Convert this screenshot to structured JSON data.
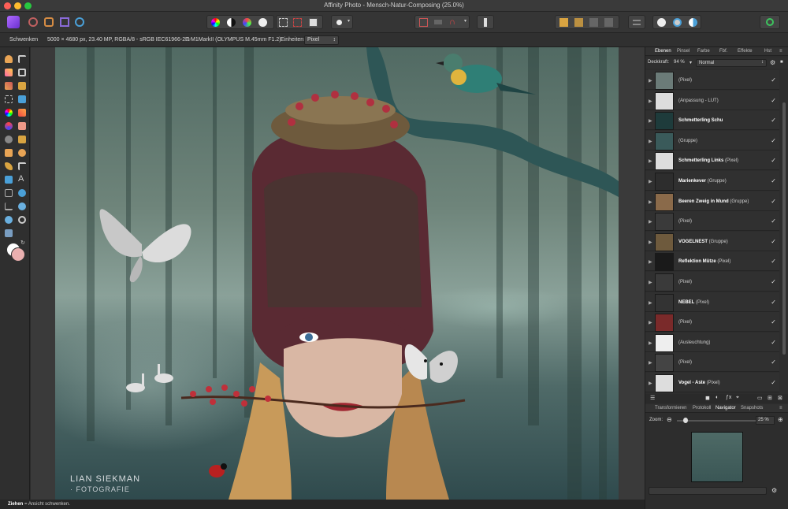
{
  "window": {
    "title": "Affinity Photo - Mensch-Natur-Composing (25.0%)"
  },
  "context": {
    "tool": "Schwenken",
    "docinfo": "5000 × 4680 px, 23.40 MP, RGBA/8 - sRGB IEC61966-2.1",
    "camera": "E-M1MarkII (OLYMPUS M.45mm F1.2)",
    "units_label": "Einheiten:",
    "units_value": "Pixel"
  },
  "canvas": {
    "watermark1": "LIAN SIEKMAN",
    "watermark2": "· FOTOGRAFIE"
  },
  "status": {
    "bold": "Ziehen",
    "rest": " = Ansicht schwenken."
  },
  "layers_panel": {
    "tabs": [
      "Ebenen",
      "Pinsel",
      "Farbe",
      "Fbf.",
      "Effekte",
      "Hst"
    ],
    "opacity_label": "Deckkraft:",
    "opacity_value": "94 %",
    "blend_mode": "Normal",
    "layers": [
      {
        "bold": "",
        "rest": "(Pixel)"
      },
      {
        "bold": "",
        "rest": "(Anpassung - LUT)"
      },
      {
        "bold": "Schmetterling Schu",
        "rest": ""
      },
      {
        "bold": "",
        "rest": "(Gruppe)"
      },
      {
        "bold": "Schmetterling Links",
        "rest": " (Pixel)"
      },
      {
        "bold": "Marienkever",
        "rest": " (Gruppe)"
      },
      {
        "bold": "Beeren Zweig in Mund",
        "rest": " (Gruppe)"
      },
      {
        "bold": "",
        "rest": "(Pixel)"
      },
      {
        "bold": "VOGELNEST",
        "rest": " (Gruppe)"
      },
      {
        "bold": "Reflektion Mütze",
        "rest": " (Pixel)"
      },
      {
        "bold": "",
        "rest": "(Pixel)"
      },
      {
        "bold": "NEBEL",
        "rest": " (Pixel)"
      },
      {
        "bold": "",
        "rest": "(Pixel)"
      },
      {
        "bold": "",
        "rest": "(Ausleuchtung)"
      },
      {
        "bold": "",
        "rest": "(Pixel)"
      },
      {
        "bold": "Vogel - Aste",
        "rest": " (Pixel)"
      }
    ]
  },
  "navigator_panel": {
    "tabs": [
      "Transformieren",
      "Protokoll",
      "Navigator",
      "Snapshots"
    ],
    "zoom_label": "Zoom:",
    "zoom_value": "25 %"
  },
  "colors": {
    "accent": "#7a4fe0",
    "panel_bg": "#2d2d2d",
    "toolbar_bg": "#353535"
  }
}
